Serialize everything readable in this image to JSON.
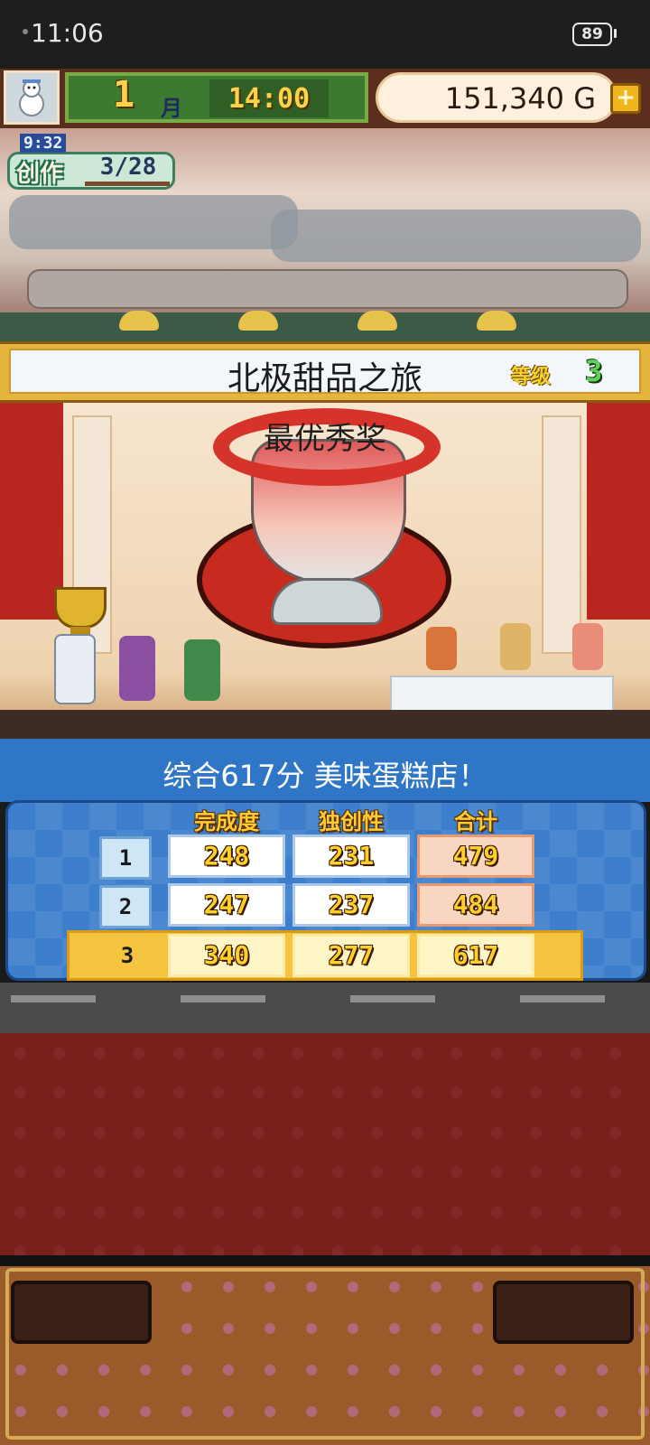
{
  "status_bar": {
    "time": "11:06",
    "battery": "89"
  },
  "hud": {
    "month_number": "1",
    "month_unit": "月",
    "clock": "14:00",
    "money": "151,340 G",
    "add_symbol": "+"
  },
  "create": {
    "timer": "9:32",
    "label": "创作",
    "progress": "3/28"
  },
  "contest": {
    "title": "北极甜品之旅",
    "grade_label": "等级",
    "grade_value": "3",
    "award": "最优秀奖"
  },
  "result": {
    "text": "综合617分 美味蛋糕店！"
  },
  "score_table": {
    "columns": [
      "完成度",
      "独创性",
      "合计"
    ],
    "rows": [
      {
        "label": "1",
        "values": [
          "248",
          "231",
          "479"
        ]
      },
      {
        "label": "2",
        "values": [
          "247",
          "237",
          "484"
        ]
      },
      {
        "label": "3",
        "values": [
          "340",
          "277",
          "617"
        ]
      }
    ]
  },
  "icons": {
    "avatar": "snowman-icon",
    "add": "plus-icon",
    "trophy": "trophy-icon"
  },
  "colors": {
    "hud_green": "#3c7a32",
    "result_blue": "#2f77c6",
    "gold": "#f5c43e"
  }
}
